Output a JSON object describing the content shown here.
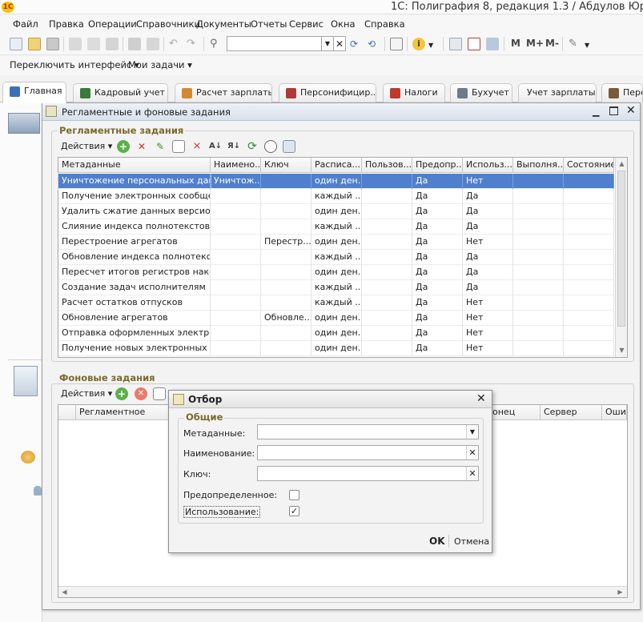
{
  "app": {
    "logo_text": "1С",
    "title": "1С: Полиграфия 8, редакция 1.3 / Абдулов Юр"
  },
  "menu": [
    "Файл",
    "Правка",
    "Операции",
    "Справочники",
    "Документы",
    "Отчеты",
    "Сервис",
    "Окна",
    "Справка"
  ],
  "toolbar": {
    "mkeys": [
      "M",
      "M+",
      "M-"
    ]
  },
  "interface_bar": {
    "switch_label": "Переключить интерфейс ▾",
    "my_tasks_label": "Мои задачи ▾"
  },
  "section_tabs": [
    {
      "label": "Главная",
      "icon_color": "#3d6fb8",
      "active": true
    },
    {
      "label": "Кадровый учет",
      "icon_color": "#3a7a3a"
    },
    {
      "label": "Расчет зарплаты",
      "icon_color": "#d38a2e"
    },
    {
      "label": "Персонифицир...",
      "icon_color": "#b03a3a"
    },
    {
      "label": "Налоги",
      "icon_color": "#c0392b"
    },
    {
      "label": "Бухучет",
      "icon_color": "#6d7a8c"
    },
    {
      "label": "Учет зарплаты",
      "icon_color": "#5a5a5a"
    },
    {
      "label": "Перс",
      "icon_color": "#7a5a3a"
    }
  ],
  "window": {
    "title": "Регламентные и фоновые задания",
    "scheduled": {
      "title": "Регламентные задания",
      "actions_label": "Действия ▾",
      "columns": [
        "Метаданные",
        "Наимено...",
        "Ключ",
        "Расписа...",
        "Пользов...",
        "Предопр...",
        "Использ...",
        "Выполня...",
        "Состояние"
      ],
      "rows": [
        [
          "Уничтожение персональных данн...",
          "Уничтож...",
          "",
          "один ден...",
          "",
          "Да",
          "Нет",
          "",
          ""
        ],
        [
          "Получение электронных сообщен...",
          "",
          "",
          "каждый ...",
          "",
          "Да",
          "Да",
          "",
          ""
        ],
        [
          "Удалить сжатие данных версион...",
          "",
          "",
          "один ден...",
          "",
          "Да",
          "Да",
          "",
          ""
        ],
        [
          "Слияние индекса полнотекстовог...",
          "",
          "",
          "каждый ...",
          "",
          "Да",
          "Да",
          "",
          ""
        ],
        [
          "Перестроение агрегатов",
          "",
          "Перестр...",
          "один ден...",
          "",
          "Да",
          "Нет",
          "",
          ""
        ],
        [
          "Обновление индекса полнотекст...",
          "",
          "",
          "каждый ...",
          "",
          "Да",
          "Да",
          "",
          ""
        ],
        [
          "Пересчет итогов регистров накоп...",
          "",
          "",
          "один ден...",
          "",
          "Да",
          "Да",
          "",
          ""
        ],
        [
          "Создание задач исполнителям",
          "",
          "",
          "каждый ...",
          "",
          "Да",
          "Да",
          "",
          ""
        ],
        [
          "Расчет остатков отпусков",
          "",
          "",
          "каждый ...",
          "",
          "Да",
          "Нет",
          "",
          ""
        ],
        [
          "Обновление агрегатов",
          "",
          "Обновле...",
          "один ден...",
          "",
          "Да",
          "Нет",
          "",
          ""
        ],
        [
          "Отправка оформленных электрон...",
          "",
          "",
          "один ден...",
          "",
          "Да",
          "Нет",
          "",
          ""
        ],
        [
          "Получение новых электронных до...",
          "",
          "",
          "один ден...",
          "",
          "Да",
          "Нет",
          "",
          ""
        ]
      ],
      "selected_row": 0
    },
    "background": {
      "title": "Фоновые задания",
      "actions_label": "Действия ▾",
      "columns": [
        "Регламентное",
        "онец",
        "Сервер",
        "Оши"
      ]
    }
  },
  "filter_dialog": {
    "title": "Отбор",
    "group_title": "Общие",
    "fields": [
      {
        "label": "Метаданные:",
        "value": "",
        "button": "▼"
      },
      {
        "label": "Наименование:",
        "value": "",
        "button": "✕"
      },
      {
        "label": "Ключ:",
        "value": "",
        "button": "✕"
      }
    ],
    "checkboxes": [
      {
        "label": "Предопределенное:",
        "checked": false
      },
      {
        "label": "Использование:",
        "checked": true
      }
    ],
    "ok_label": "OK",
    "cancel_label": "Отмена"
  }
}
